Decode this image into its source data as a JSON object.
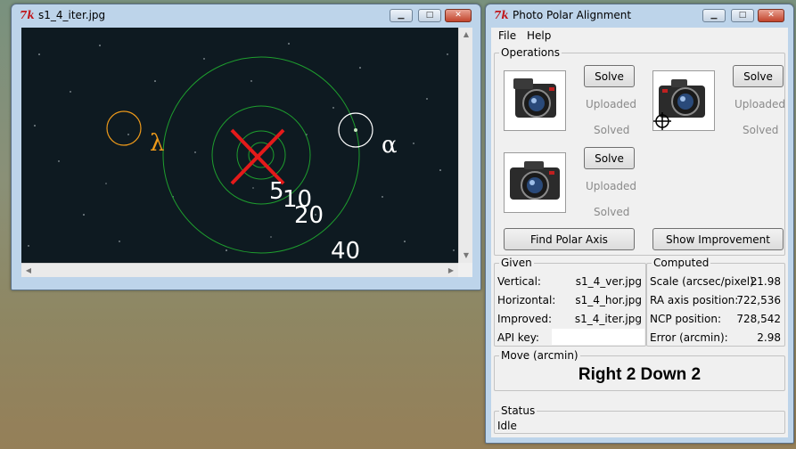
{
  "image_window": {
    "title": "s1_4_iter.jpg",
    "icon": "tk-feather-icon",
    "overlay": {
      "star_left_label": "λ",
      "star_right_label": "α",
      "ring_labels": [
        "5",
        "10",
        "20",
        "40"
      ]
    }
  },
  "app_window": {
    "title": "Photo Polar Alignment",
    "icon": "tk-feather-icon",
    "menu": [
      "File",
      "Help"
    ],
    "operations": {
      "label": "Operations",
      "vertical": {
        "solve": "Solve",
        "uploaded": "Uploaded",
        "solved": "Solved",
        "icon": "camera-icon"
      },
      "horizontal": {
        "solve": "Solve",
        "uploaded": "Uploaded",
        "solved": "Solved",
        "icon": "camera-crosshair-icon"
      },
      "improved": {
        "solve": "Solve",
        "uploaded": "Uploaded",
        "solved": "Solved",
        "icon": "camera-icon"
      },
      "find_polar_axis": "Find Polar Axis",
      "show_improvement": "Show Improvement"
    },
    "given": {
      "label": "Given",
      "rows": [
        {
          "label": "Vertical:",
          "value": "s1_4_ver.jpg"
        },
        {
          "label": "Horizontal:",
          "value": "s1_4_hor.jpg"
        },
        {
          "label": "Improved:",
          "value": "s1_4_iter.jpg"
        },
        {
          "label": "API key:",
          "value": ""
        }
      ]
    },
    "computed": {
      "label": "Computed",
      "rows": [
        {
          "label": "Scale (arcsec/pixel):",
          "value": "21.98"
        },
        {
          "label": "RA axis position:",
          "value": "722,536"
        },
        {
          "label": "NCP position:",
          "value": "728,542"
        },
        {
          "label": "Error (arcmin):",
          "value": "2.98"
        }
      ]
    },
    "move": {
      "label": "Move (arcmin)",
      "value": "Right 2 Down 2"
    },
    "status": {
      "label": "Status",
      "value": "Idle"
    }
  },
  "colors": {
    "titlebar": "#bdd4ea",
    "canvas_bg": "#0e1a21",
    "ring": "#1e9e2e",
    "cross": "#e41a1a",
    "lambda": "#ee9a1a",
    "alpha": "#ffffff"
  }
}
